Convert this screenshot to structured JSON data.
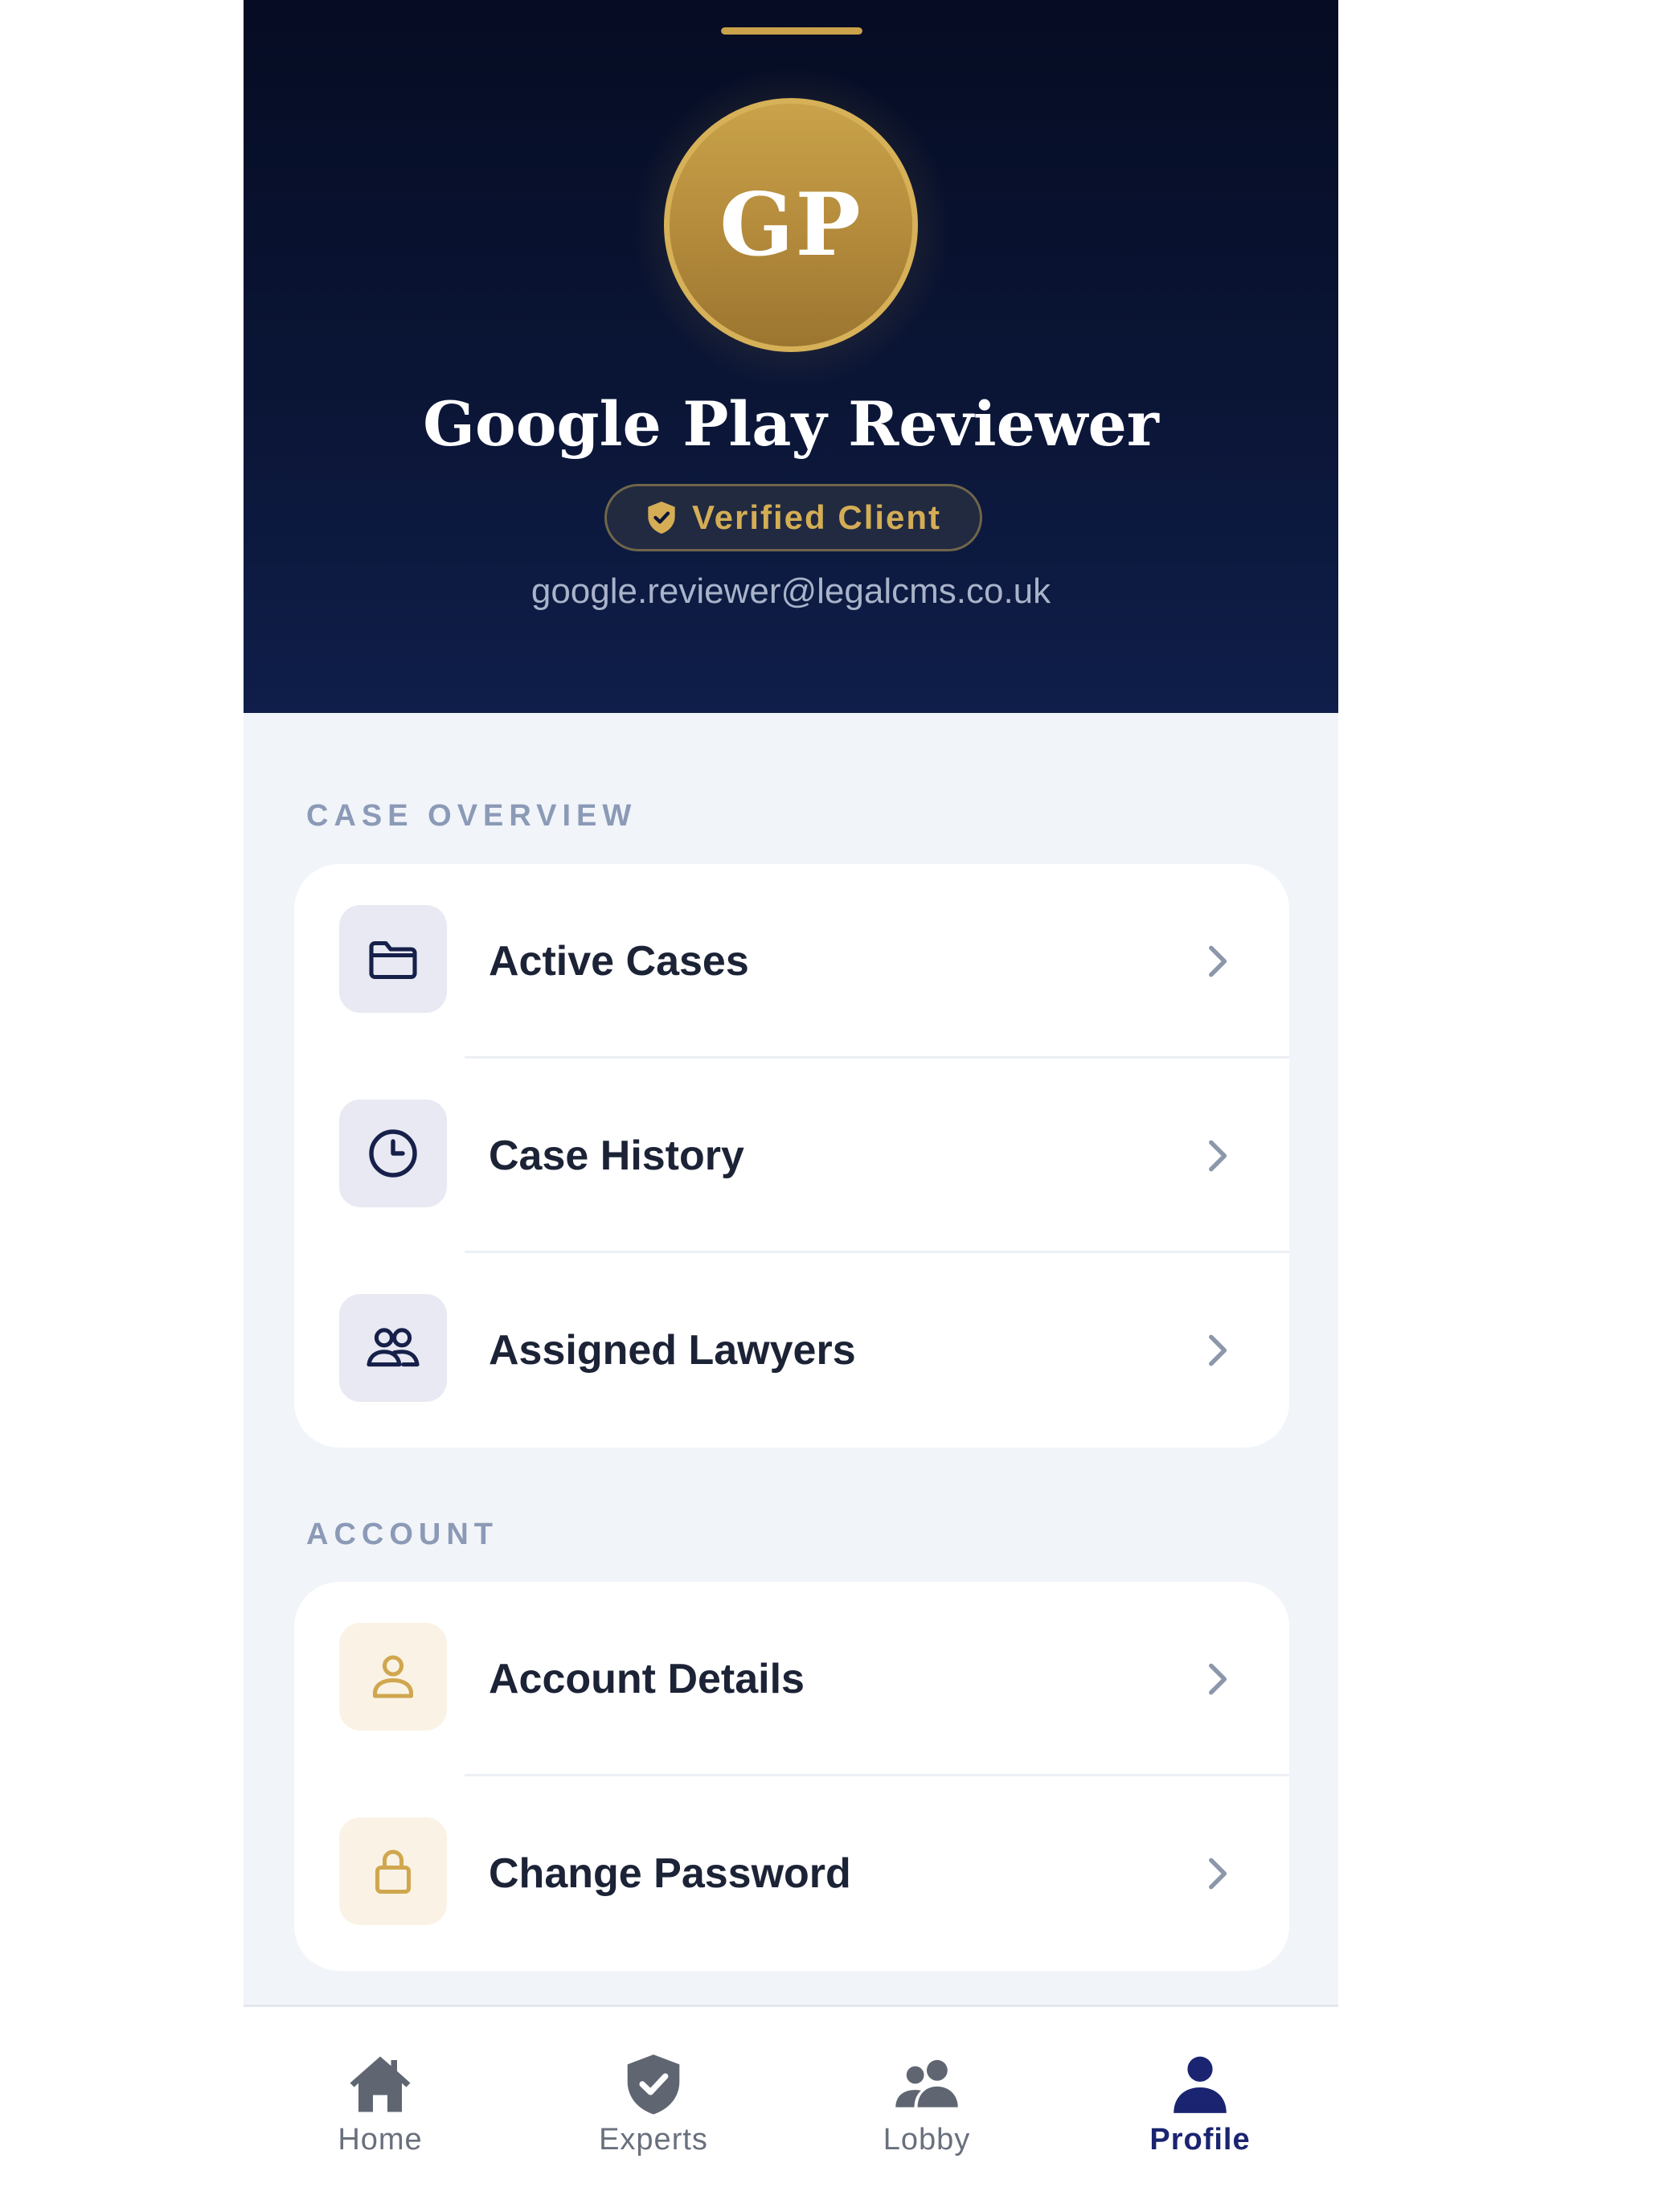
{
  "colors": {
    "navy": "#0b1638",
    "gold": "#d4ad55",
    "active_tab": "#1a2470",
    "inactive_tab": "#69707d",
    "background": "#f1f4f9"
  },
  "header": {
    "avatar_initials": "GP",
    "name": "Google Play Reviewer",
    "badge_icon": "shield-check-icon",
    "badge_label": "Verified Client",
    "email": "google.reviewer@legalcms.co.uk"
  },
  "sections": [
    {
      "title": "CASE OVERVIEW",
      "items": [
        {
          "label": "Active Cases",
          "icon": "folder-icon"
        },
        {
          "label": "Case History",
          "icon": "clock-icon"
        },
        {
          "label": "Assigned Lawyers",
          "icon": "users-icon"
        }
      ]
    },
    {
      "title": "ACCOUNT",
      "items": [
        {
          "label": "Account Details",
          "icon": "user-icon"
        },
        {
          "label": "Change Password",
          "icon": "lock-icon"
        }
      ]
    }
  ],
  "tabbar": {
    "active": "Profile",
    "tabs": [
      {
        "label": "Home",
        "icon": "home-icon"
      },
      {
        "label": "Experts",
        "icon": "shield-check-icon"
      },
      {
        "label": "Lobby",
        "icon": "people-icon"
      },
      {
        "label": "Profile",
        "icon": "person-icon"
      }
    ]
  }
}
